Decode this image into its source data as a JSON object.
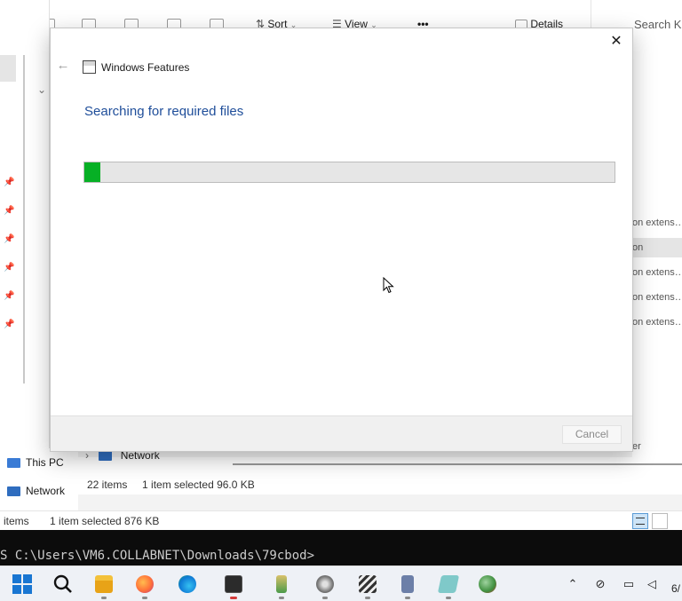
{
  "dialog": {
    "title": "Windows Features",
    "heading": "Searching for required files",
    "progress_fraction": 0.03,
    "progress_color": "#06b025",
    "cancel_label": "Cancel",
    "close_icon": "close-icon",
    "back_icon": "back-arrow-icon"
  },
  "explorer_toolbar": {
    "sort_label": "Sort",
    "view_label": "View",
    "more_label": "•••",
    "details_label": "Details",
    "search_placeholder": "Search K"
  },
  "explorer_right_list": [
    {
      "text": "on extens…",
      "selected": false
    },
    {
      "text": "on",
      "selected": true
    },
    {
      "text": "on extens…",
      "selected": false
    },
    {
      "text": "on extens…",
      "selected": false
    },
    {
      "text": "on extens…",
      "selected": false
    },
    {
      "text": "er",
      "selected": false
    }
  ],
  "navigation": {
    "this_pc": "This PC",
    "network": "Network",
    "network_tree_item": "Network"
  },
  "status_bar_front": {
    "items": "22 items",
    "selection": "1 item selected  96.0 KB"
  },
  "status_bar_back": {
    "items": "items",
    "selection": "1 item selected  876 KB"
  },
  "terminal": {
    "prompt": "S C:\\Users\\VM6.COLLABNET\\Downloads\\79cbod>"
  },
  "taskbar": {
    "apps": [
      "start-icon",
      "search-icon",
      "file-explorer-icon",
      "firefox-icon",
      "edge-icon",
      "terminal-icon",
      "paint-icon",
      "media-icon",
      "clapper-icon",
      "notebook-icon",
      "notepad-icon",
      "globe-app-icon"
    ],
    "clock_fragment": "6/"
  },
  "colors": {
    "accent_text": "#1f4e9a",
    "progress": "#06b025"
  }
}
